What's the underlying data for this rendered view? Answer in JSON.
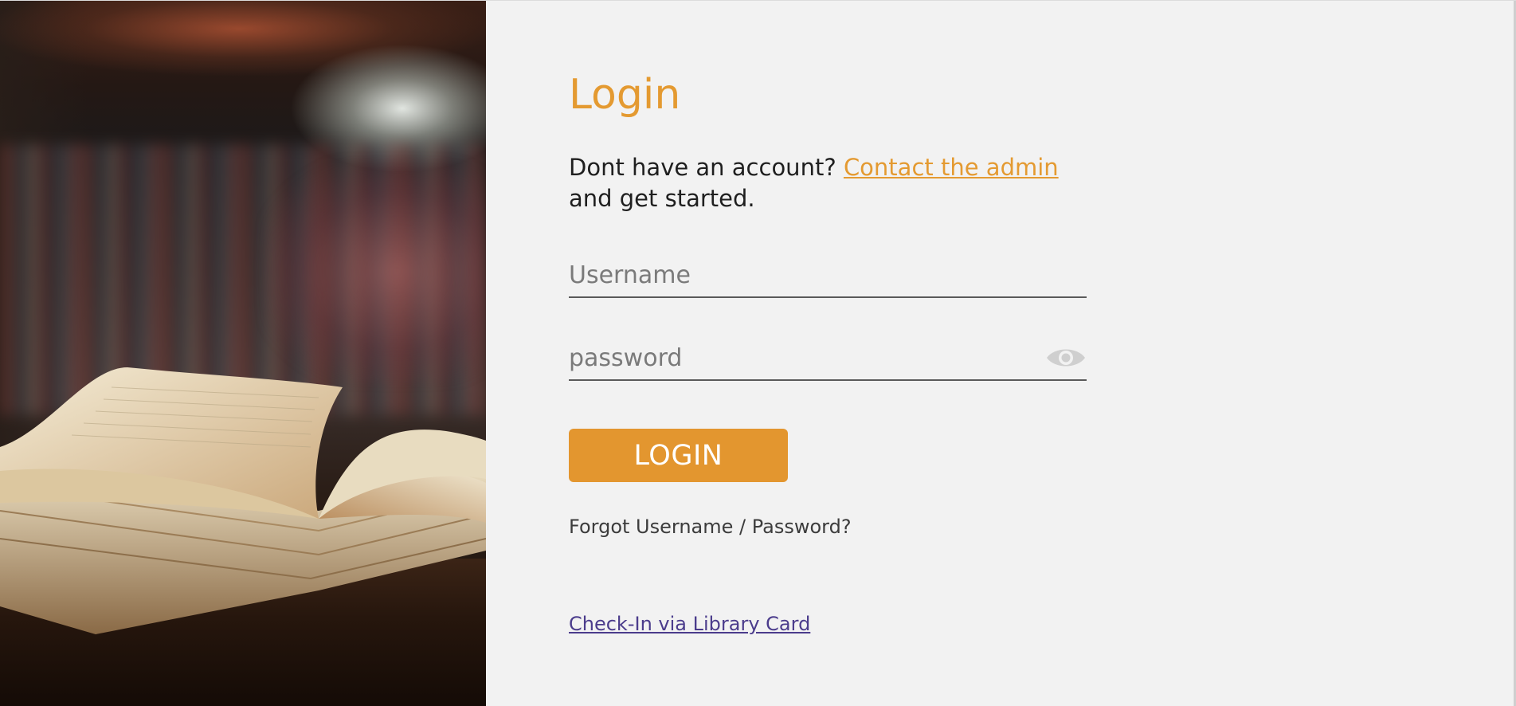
{
  "hero": {
    "image_alt": "open-book-on-library-table"
  },
  "login": {
    "title": "Login",
    "intro_text": "Dont have an account?",
    "contact_link": "Contact the admin",
    "intro_suffix": "and get started.",
    "username_placeholder": "Username",
    "password_placeholder": "password",
    "login_button": "LOGIN",
    "forgot_text": "Forgot Username / Password?",
    "checkin_link": "Check-In via Library Card"
  },
  "colors": {
    "accent": "#e49a31",
    "background": "#f2f2f2",
    "text": "#1f1f1f",
    "link": "#4b3c8c"
  },
  "icons": {
    "password_toggle": "eye-icon"
  }
}
